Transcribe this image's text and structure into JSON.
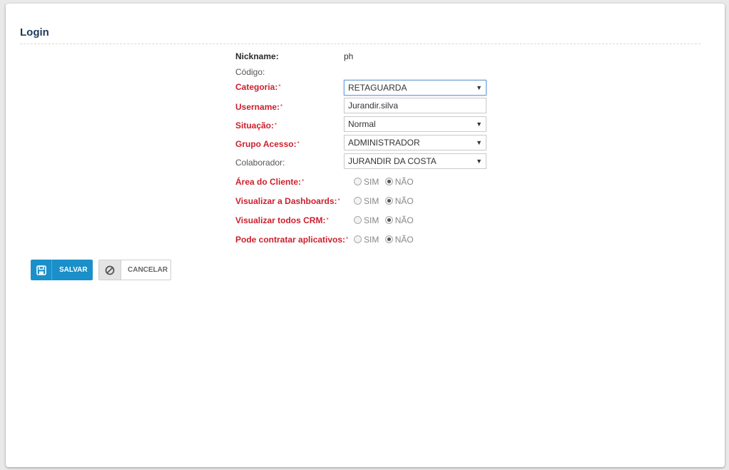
{
  "panel": {
    "title": "Login"
  },
  "form": {
    "nickname": {
      "label": "Nickname:",
      "value": "ph"
    },
    "codigo": {
      "label": "Código:"
    },
    "categoria": {
      "label": "Categoria:",
      "value": "RETAGUARDA"
    },
    "username": {
      "label": "Username:",
      "value": "Jurandir.silva"
    },
    "situacao": {
      "label": "Situação:",
      "value": "Normal"
    },
    "grupo_acesso": {
      "label": "Grupo Acesso:",
      "value": "ADMINISTRADOR"
    },
    "colaborador": {
      "label": "Colaborador:",
      "value": "JURANDIR DA COSTA"
    },
    "required_marker": "*",
    "radio_options": {
      "yes": "SIM",
      "no": "NÃO"
    },
    "area_cliente": {
      "label": "Área do Cliente:",
      "selected": "NÃO"
    },
    "visualizar_dashboards": {
      "label": "Visualizar a Dashboards:",
      "selected": "NÃO"
    },
    "visualizar_crm": {
      "label": "Visualizar todos CRM:",
      "selected": "NÃO"
    },
    "pode_contratar": {
      "label": "Pode contratar aplicativos:",
      "selected": "NÃO"
    }
  },
  "buttons": {
    "save": "SALVAR",
    "cancel": "CANCELAR"
  },
  "icons": {
    "save": "floppy-disk-icon",
    "cancel": "ban-icon",
    "dropdown": "caret-down-icon"
  },
  "colors": {
    "primary": "#1a8fc9",
    "required": "#cc1f2d",
    "title": "#1f3a5a"
  }
}
